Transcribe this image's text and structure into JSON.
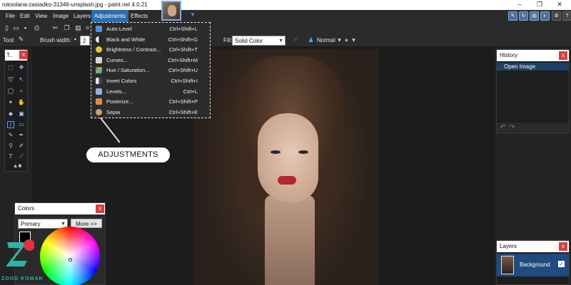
{
  "window": {
    "title": "roksolana-zasiadko-31346-unsplash.jpg - paint.net 4.0.21",
    "controls": [
      "–",
      "❐",
      "✕"
    ]
  },
  "menubar": {
    "items": [
      "File",
      "Edit",
      "View",
      "Image",
      "Layers",
      "Adjustments",
      "Effects"
    ],
    "active": "Adjustments"
  },
  "toolbar": {
    "tool_label": "Tool:",
    "brush_width_label": "Brush width:",
    "brush_width_value": "2",
    "fill_label": "Fill:",
    "fill_value": "Solid Color",
    "blend_value": "Normal"
  },
  "adjustments_menu": [
    {
      "label": "Auto-Level",
      "shortcut": "Ctrl+Shift+L",
      "icon": "auto-level-icon",
      "color": "#5a8fd8"
    },
    {
      "label": "Black and White",
      "shortcut": "Ctrl+Shift+G",
      "icon": "black-white-icon",
      "color": "#cfcfcf"
    },
    {
      "label": "Brightness / Contrast...",
      "shortcut": "Ctrl+Shift+T",
      "icon": "brightness-contrast-icon",
      "color": "#f0c040"
    },
    {
      "label": "Curves...",
      "shortcut": "Ctrl+Shift+M",
      "icon": "curves-icon",
      "color": "#d9d9d9"
    },
    {
      "label": "Hue / Saturation...",
      "shortcut": "Ctrl+Shift+U",
      "icon": "hue-saturation-icon",
      "color": "#7bc46b"
    },
    {
      "label": "Invert Colors",
      "shortcut": "Ctrl+Shift+I",
      "icon": "invert-colors-icon",
      "color": "#e8e8e8"
    },
    {
      "label": "Levels...",
      "shortcut": "Ctrl+L",
      "icon": "levels-icon",
      "color": "#8fb4e0"
    },
    {
      "label": "Posterize...",
      "shortcut": "Ctrl+Shift+P",
      "icon": "posterize-icon",
      "color": "#e08b4a"
    },
    {
      "label": "Sepia",
      "shortcut": "Ctrl+Shift+E",
      "icon": "sepia-icon",
      "color": "#c9a27a"
    }
  ],
  "callout": {
    "label": "ADJUSTMENTS"
  },
  "tools_panel": {
    "title": "T.."
  },
  "history_panel": {
    "title": "History",
    "items": [
      "Open Image"
    ]
  },
  "layers_panel": {
    "title": "Layers",
    "layers": [
      {
        "name": "Background",
        "visible": true
      }
    ]
  },
  "colors_panel": {
    "title": "Colors",
    "mode_value": "Primary",
    "more_button": "More >>",
    "primary_color": "#000000",
    "secondary_color": "#ffffff"
  },
  "accent_color": "#2a6db3",
  "close_glyph": "x",
  "watermark": {
    "text": "ZOOD KOMAK"
  }
}
